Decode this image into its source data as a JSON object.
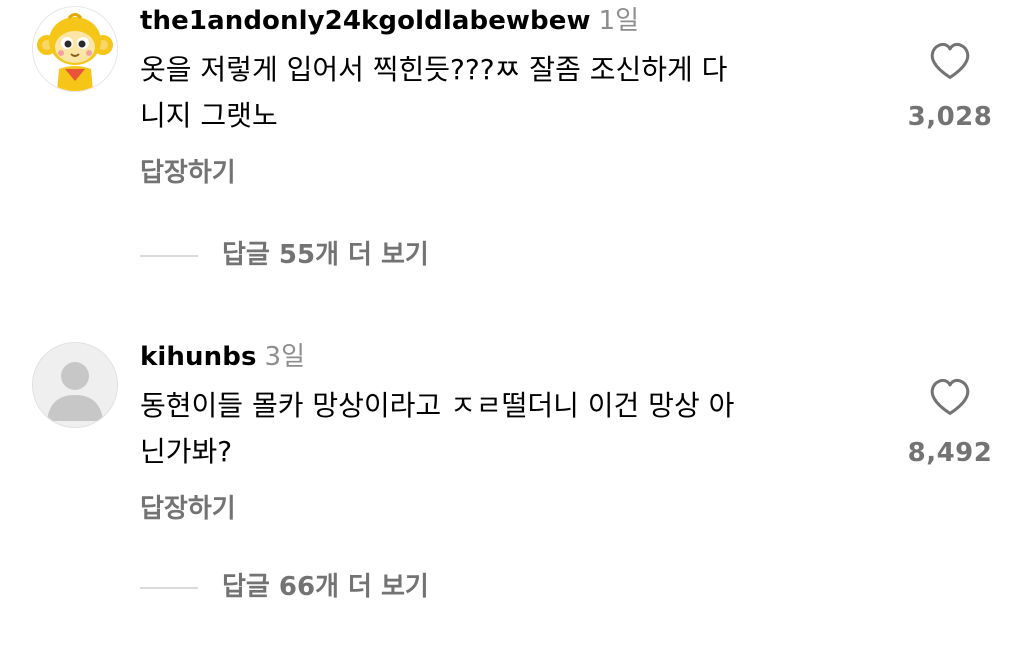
{
  "comments": [
    {
      "username": "the1andonly24kgoldlabewbew",
      "time": "1일",
      "line1": "옷을 저렇게 입어서 찍힌듯???ㅉ 잘좀 조신하게 다",
      "line2": "니지 그랫노",
      "reply_label": "답장하기",
      "likes": "3,028",
      "more_replies": "답글 55개 더 보기",
      "avatar_icon": "yellow-monkey-character-avatar"
    },
    {
      "username": "kihunbs",
      "time": "3일",
      "line1": "동현이들 몰카 망상이라고 ㅈㄹ떨더니 이건 망상 아",
      "line2": "닌가봐?",
      "reply_label": "답장하기",
      "likes": "8,492",
      "more_replies": "답글 66개 더 보기",
      "avatar_icon": "default-user-avatar"
    }
  ],
  "icons": {
    "like": "heart-outline-icon"
  },
  "colors": {
    "secondary_text": "#737373",
    "timestamp": "#8e8e8e",
    "divider": "#dbdbdb",
    "avatar_yellow": "#f5c518"
  }
}
